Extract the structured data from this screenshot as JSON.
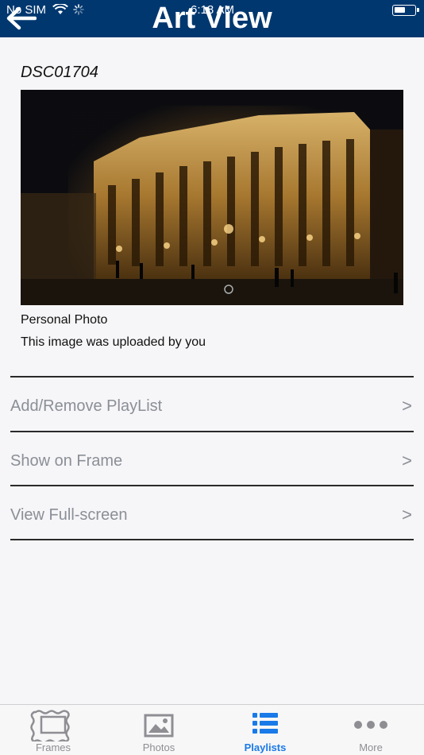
{
  "status_bar": {
    "carrier": "No SIM",
    "time": "6:18 AM"
  },
  "header": {
    "title": "Art View",
    "back_icon": "back-arrow-icon"
  },
  "art": {
    "filename": "DSC01704",
    "photo_type": "Personal Photo",
    "upload_note": "This image was uploaded by you"
  },
  "actions": [
    {
      "label": "Add/Remove PlayList",
      "chevron": ">"
    },
    {
      "label": "Show on Frame",
      "chevron": ">"
    },
    {
      "label": "View Full-screen",
      "chevron": ">"
    }
  ],
  "tabs": [
    {
      "label": "Frames",
      "icon": "frame-icon"
    },
    {
      "label": "Photos",
      "icon": "photo-icon"
    },
    {
      "label": "Playlists",
      "icon": "list-icon",
      "active": true
    },
    {
      "label": "More",
      "icon": "more-icon"
    }
  ],
  "colors": {
    "header_bg": "#00376f",
    "active_tab": "#1a7ae8",
    "inactive": "#8e8e93",
    "row_text": "#8a8f97"
  }
}
